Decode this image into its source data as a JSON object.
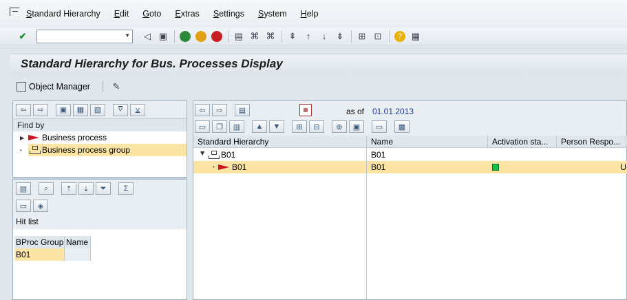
{
  "menu": {
    "items": [
      "Standard Hierarchy",
      "Edit",
      "Goto",
      "Extras",
      "Settings",
      "System",
      "Help"
    ]
  },
  "title": "Standard Hierarchy for Bus. Processes Display",
  "app_toolbar": {
    "object_manager": "Object Manager"
  },
  "left_panel": {
    "find_by_label": "Find by",
    "tree": [
      {
        "label": "Business process",
        "icon": "business-process-icon",
        "selected": false
      },
      {
        "label": "Business process group",
        "icon": "process-group-icon",
        "selected": true
      }
    ],
    "hit_list_label": "Hit list",
    "hit_table": {
      "headers": [
        "BProc Group",
        "Name"
      ],
      "rows": [
        [
          "B01",
          ""
        ]
      ]
    }
  },
  "right_panel": {
    "as_of_label": "as of",
    "as_of_date": "01.01.2013",
    "columns": [
      "Standard Hierarchy",
      "Name",
      "Activation sta...",
      "Person Respo..."
    ],
    "rows": [
      {
        "hierarchy": "B01",
        "name": "B01",
        "status": "",
        "person": ""
      },
      {
        "hierarchy": "B01",
        "name": "B01",
        "status": "active",
        "person": "U"
      }
    ]
  },
  "colors": {
    "selection": "#fce4a4",
    "status_green": "#13c44a",
    "process_red": "#c9161d"
  }
}
